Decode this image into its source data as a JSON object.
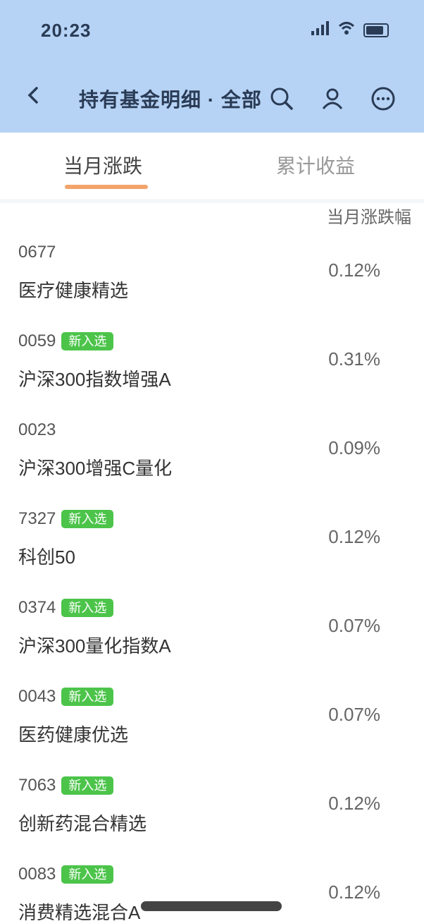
{
  "status_bar": {
    "time": "20:23",
    "signal_icon": "signal-icon",
    "wifi_icon": "wifi-icon",
    "battery_icon": "battery-icon"
  },
  "app_bar": {
    "back_icon": "back-arrow-icon",
    "title": "持有基金明细 · 全部",
    "icons": [
      "search-icon",
      "person-icon",
      "more-icon"
    ]
  },
  "tabs": [
    {
      "label": "当月涨跌",
      "active": true
    },
    {
      "label": "累计收益",
      "active": false
    }
  ],
  "list_header": "当月涨跌幅",
  "rows": [
    {
      "code": "0677",
      "badge": "",
      "name": "医疗健康精选",
      "value": "0.12%"
    },
    {
      "code": "0059",
      "badge": "新入选",
      "name": "沪深300指数增强A",
      "value": "0.31%"
    },
    {
      "code": "0023",
      "badge": "",
      "name": "沪深300增强C量化",
      "value": "0.09%"
    },
    {
      "code": "7327",
      "badge": "新入选",
      "name": "科创50",
      "value": "0.12%"
    },
    {
      "code": "0374",
      "badge": "新入选",
      "name": "沪深300量化指数A",
      "value": "0.07%"
    },
    {
      "code": "0043",
      "badge": "新入选",
      "name": "医药健康优选",
      "value": "0.07%"
    },
    {
      "code": "7063",
      "badge": "新入选",
      "name": "创新药混合精选",
      "value": "0.12%"
    },
    {
      "code": "0083",
      "badge": "新入选",
      "name": "消费精选混合A",
      "value": "0.12%"
    }
  ],
  "colors": {
    "header_bg": "#b6d3f5",
    "tab_underline": "#f3a46b",
    "badge_bg": "#4cc44a"
  }
}
